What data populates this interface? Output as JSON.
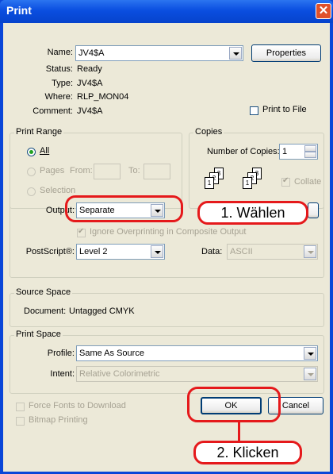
{
  "window": {
    "title": "Print",
    "close_glyph": "✕"
  },
  "printer": {
    "name_label": "Name:",
    "name_value": "JV4$A",
    "properties_button": "Properties",
    "status_label": "Status:",
    "status_value": "Ready",
    "type_label": "Type:",
    "type_value": "JV4$A",
    "where_label": "Where:",
    "where_value": "RLP_MON04",
    "comment_label": "Comment:",
    "comment_value": "JV4$A",
    "print_to_file": "Print to File"
  },
  "print_range": {
    "title": "Print Range",
    "all": "All",
    "pages": "Pages",
    "from": "From:",
    "to": "To:",
    "selection": "Selection"
  },
  "copies": {
    "title": "Copies",
    "number_label": "Number of Copies:",
    "number_value": "1",
    "collate": "Collate",
    "collate_checked": true,
    "page_labels": [
      "1",
      "2",
      "3"
    ]
  },
  "output": {
    "output_label": "Output:",
    "output_value": "Separate",
    "ignore_overprinting": "Ignore Overprinting in Composite Output",
    "postscript_label": "PostScript®:",
    "postscript_value": "Level 2",
    "data_label": "Data:",
    "data_value": "ASCII"
  },
  "source_space": {
    "title": "Source Space",
    "document_label": "Document:",
    "document_value": "Untagged CMYK"
  },
  "print_space": {
    "title": "Print Space",
    "profile_label": "Profile:",
    "profile_value": "Same As Source",
    "intent_label": "Intent:",
    "intent_value": "Relative Colorimetric"
  },
  "options": {
    "force_fonts": "Force Fonts to Download",
    "bitmap_printing": "Bitmap Printing"
  },
  "buttons": {
    "ok": "OK",
    "cancel": "Cancel"
  },
  "annotations": {
    "step1": "1. Wählen",
    "step2": "2. Klicken",
    "color": "#e5191b"
  }
}
